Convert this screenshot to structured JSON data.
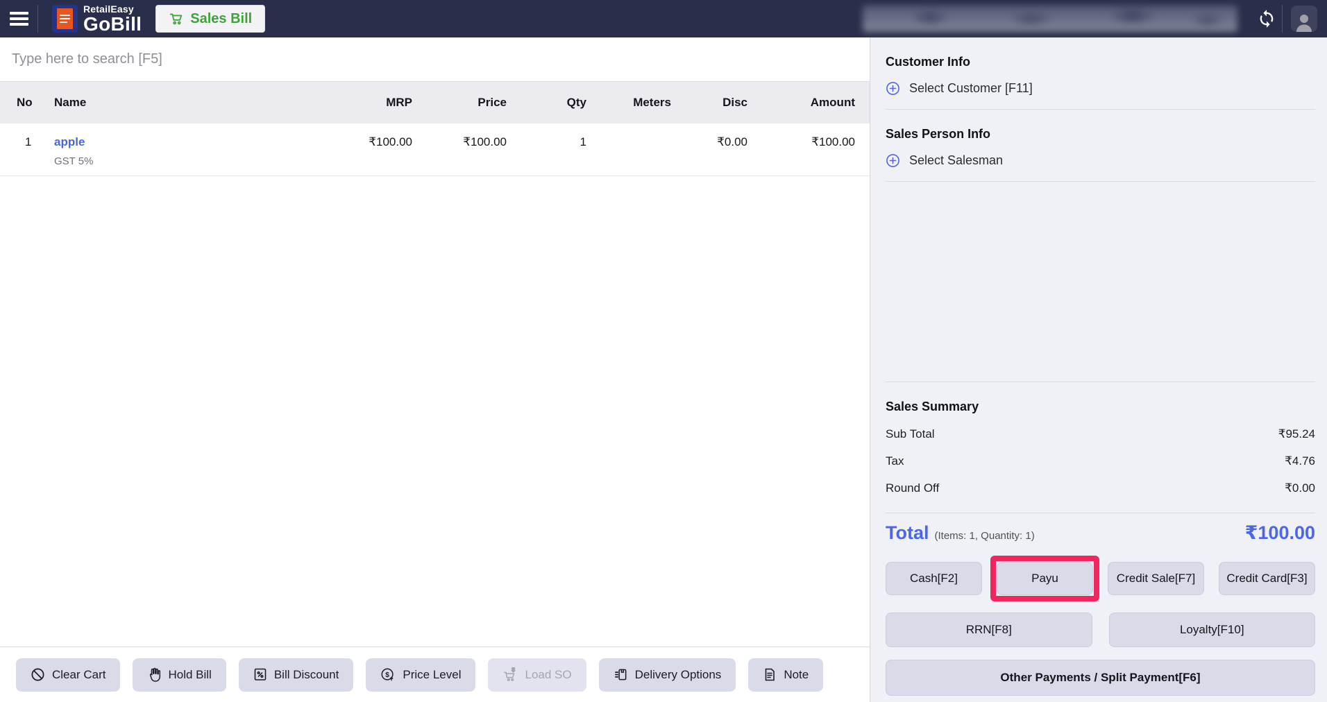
{
  "navbar": {
    "brand_top": "RetailEasy",
    "brand_bottom": "GoBill",
    "sales_bill_label": "Sales Bill"
  },
  "search": {
    "placeholder": "Type here to search [F5]"
  },
  "table": {
    "headers": {
      "no": "No",
      "name": "Name",
      "mrp": "MRP",
      "price": "Price",
      "qty": "Qty",
      "meters": "Meters",
      "disc": "Disc",
      "amount": "Amount"
    },
    "rows": [
      {
        "no": "1",
        "name": "apple",
        "tax": "GST 5%",
        "mrp": "₹100.00",
        "price": "₹100.00",
        "qty": "1",
        "meters": "",
        "disc": "₹0.00",
        "amount": "₹100.00"
      }
    ]
  },
  "customer": {
    "title": "Customer Info",
    "select_label": "Select Customer [F11]"
  },
  "salesperson": {
    "title": "Sales Person Info",
    "select_label": "Select Salesman"
  },
  "summary": {
    "title": "Sales Summary",
    "rows": [
      {
        "label": "Sub Total",
        "value": "₹95.24"
      },
      {
        "label": "Tax",
        "value": "₹4.76"
      },
      {
        "label": "Round Off",
        "value": "₹0.00"
      }
    ]
  },
  "total": {
    "label": "Total",
    "meta": "(Items: 1, Quantity: 1)",
    "amount": "₹100.00"
  },
  "payments": {
    "cash": "Cash[F2]",
    "payu": "Payu",
    "credit_sale": "Credit Sale[F7]",
    "credit_card": "Credit Card[F3]",
    "rrn": "RRN[F8]",
    "loyalty": "Loyalty[F10]",
    "other": "Other Payments / Split Payment[F6]"
  },
  "actions": {
    "clear_cart": "Clear Cart",
    "hold_bill": "Hold Bill",
    "bill_discount": "Bill Discount",
    "price_level": "Price Level",
    "load_so": "Load SO",
    "delivery_options": "Delivery Options",
    "note": "Note"
  },
  "colors": {
    "navbar": "#292e4a",
    "accent_blue": "#4c66ea",
    "link_blue": "#4667e0",
    "highlight_pink": "#f1265e",
    "brand_green": "#3fa23c",
    "button_bg": "#d9dbe9",
    "panel_bg": "#f0f1f6"
  }
}
